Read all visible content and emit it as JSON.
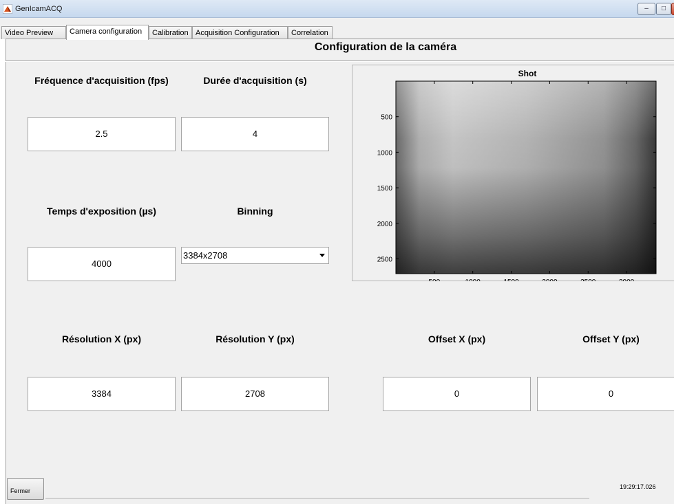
{
  "window": {
    "title": "GenIcamACQ"
  },
  "tabs": [
    {
      "label": "Video Preview"
    },
    {
      "label": "Camera configuration"
    },
    {
      "label": "Calibration"
    },
    {
      "label": "Acquisition Configuration"
    },
    {
      "label": "Correlation"
    }
  ],
  "active_tab": "Camera configuration",
  "page": {
    "title": "Configuration de la caméra"
  },
  "fields": {
    "frequence": {
      "label": "Fréquence d'acquisition (fps)",
      "value": "2.5"
    },
    "duree": {
      "label": "Durée d'acquisition (s)",
      "value": "4"
    },
    "exposition": {
      "label": "Temps d'exposition (µs)",
      "value": "4000"
    },
    "binning": {
      "label": "Binning",
      "value": "3384x2708"
    },
    "resolution_x": {
      "label": "Résolution X (px)",
      "value": "3384"
    },
    "resolution_y": {
      "label": "Résolution Y (px)",
      "value": "2708"
    },
    "offset_x": {
      "label": "Offset X (px)",
      "value": "0"
    },
    "offset_y": {
      "label": "Offset Y (px)",
      "value": "0"
    }
  },
  "chart_data": {
    "type": "heatmap",
    "title": "Shot",
    "xticks": [
      "500",
      "1000",
      "1500",
      "2000",
      "2500",
      "3000"
    ],
    "yticks": [
      "500",
      "1000",
      "1500",
      "2000",
      "2500"
    ],
    "xlim": [
      0,
      3384
    ],
    "ylim": [
      0,
      2708
    ],
    "colormap": "gray"
  },
  "buttons": {
    "close_label": "Fermer"
  },
  "status": {
    "timestamp": "19:29:17.026"
  }
}
